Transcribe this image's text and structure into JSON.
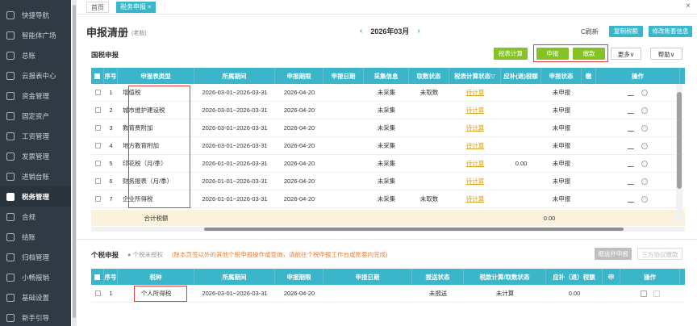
{
  "sidebar": {
    "items": [
      {
        "label": "快捷导航",
        "icon": "home-icon"
      },
      {
        "label": "智能体广场",
        "icon": "grid-icon"
      },
      {
        "label": "总账",
        "icon": "ledger-icon"
      },
      {
        "label": "云报表中心",
        "icon": "chart-icon"
      },
      {
        "label": "资金管理",
        "icon": "wallet-icon"
      },
      {
        "label": "固定资产",
        "icon": "asset-icon"
      },
      {
        "label": "工资管理",
        "icon": "salary-icon"
      },
      {
        "label": "发票管理",
        "icon": "invoice-icon"
      },
      {
        "label": "进销台账",
        "icon": "inventory-icon"
      },
      {
        "label": "税务管理",
        "icon": "tax-icon",
        "active": true
      },
      {
        "label": "合规",
        "icon": "compliance-icon"
      },
      {
        "label": "结账",
        "icon": "closing-icon"
      },
      {
        "label": "归档管理",
        "icon": "archive-icon"
      },
      {
        "label": "小畅报销",
        "icon": "reimburse-icon"
      },
      {
        "label": "基础设置",
        "icon": "settings-icon"
      },
      {
        "label": "新手引导",
        "icon": "guide-icon"
      }
    ]
  },
  "tabs": [
    {
      "label": "首页"
    },
    {
      "label": "税务申报",
      "close": "×"
    }
  ],
  "window": {
    "close": "×"
  },
  "header": {
    "title": "申报清册",
    "subtitle": "(老版)",
    "prev": "‹",
    "period": "2026年03月",
    "next": "›",
    "refresh": "C刷新",
    "copy": "复制税额",
    "modify": "修改账套信息"
  },
  "national": {
    "title": "国税申报",
    "buttons": {
      "calc": "税表计算",
      "declare": "申报",
      "pay": "缴款",
      "more": "更多∨",
      "help": "帮助∨"
    },
    "columns": [
      "",
      "序号",
      "申报表类型",
      "所属期间",
      "申报期限",
      "申报日期",
      "采集信息",
      "取数状态",
      "税表计算状态▽",
      "应补(退)税额",
      "申报状态",
      "缴",
      "操作"
    ],
    "rows": [
      {
        "no": "1",
        "type": "增值税",
        "period": "2026-03-01~2026-03-31",
        "deadline": "2026-04-20",
        "date": "",
        "collect": "未采集",
        "fetch": "未取数",
        "calc": "待计算",
        "amount": "",
        "status": "未申报"
      },
      {
        "no": "2",
        "type": "城市维护建设税",
        "period": "2026-03-01~2026-03-31",
        "deadline": "2026-04-20",
        "date": "",
        "collect": "未采集",
        "fetch": "",
        "calc": "待计算",
        "amount": "",
        "status": "未申报"
      },
      {
        "no": "3",
        "type": "教育费附加",
        "period": "2026-03-01~2026-03-31",
        "deadline": "2026-04-20",
        "date": "",
        "collect": "未采集",
        "fetch": "",
        "calc": "待计算",
        "amount": "",
        "status": "未申报"
      },
      {
        "no": "4",
        "type": "地方教育附加",
        "period": "2026-03-01~2026-03-31",
        "deadline": "2026-04-20",
        "date": "",
        "collect": "未采集",
        "fetch": "",
        "calc": "待计算",
        "amount": "",
        "status": "未申报"
      },
      {
        "no": "5",
        "type": "印花税（月/季）",
        "period": "2026-01-01~2026-03-31",
        "deadline": "2026-04-20",
        "date": "",
        "collect": "未采集",
        "fetch": "",
        "calc": "待计算",
        "amount": "0.00",
        "status": "未申报"
      },
      {
        "no": "6",
        "type": "财务报表（月/季）",
        "period": "2026-01-01~2026-03-31",
        "deadline": "2026-04-20",
        "date": "",
        "collect": "未采集",
        "fetch": "",
        "calc": "待计算",
        "amount": "",
        "status": "未申报"
      },
      {
        "no": "7",
        "type": "企业所得税",
        "period": "2026-01-01~2026-03-31",
        "deadline": "2026-04-20",
        "date": "",
        "collect": "未采集",
        "fetch": "未取数",
        "calc": "待计算",
        "amount": "",
        "status": "未申报"
      }
    ],
    "sum_label": "合计税额",
    "sum_value": "0.00"
  },
  "personal": {
    "title": "个税申报",
    "auth": "● 个税未授权",
    "note": "(除本页签以外的其他个税申报操作或查询，请前往个税申报工作台或账套内完成)",
    "buttons": {
      "send": "报送并申报",
      "tripartite": "三方协议缴款"
    },
    "columns": [
      "",
      "序号",
      "税种",
      "所属期间",
      "申报期限",
      "申报日期",
      "报送状态",
      "税款计算/取数状态",
      "应补（退）税额",
      "申",
      "操作"
    ],
    "rows": [
      {
        "no": "1",
        "type": "个人所得税",
        "period": "2026-03-01~2026-03-31",
        "deadline": "2026-04-20",
        "date": "",
        "send": "未报送",
        "calc": "未计算",
        "amount": "0.00"
      }
    ]
  }
}
